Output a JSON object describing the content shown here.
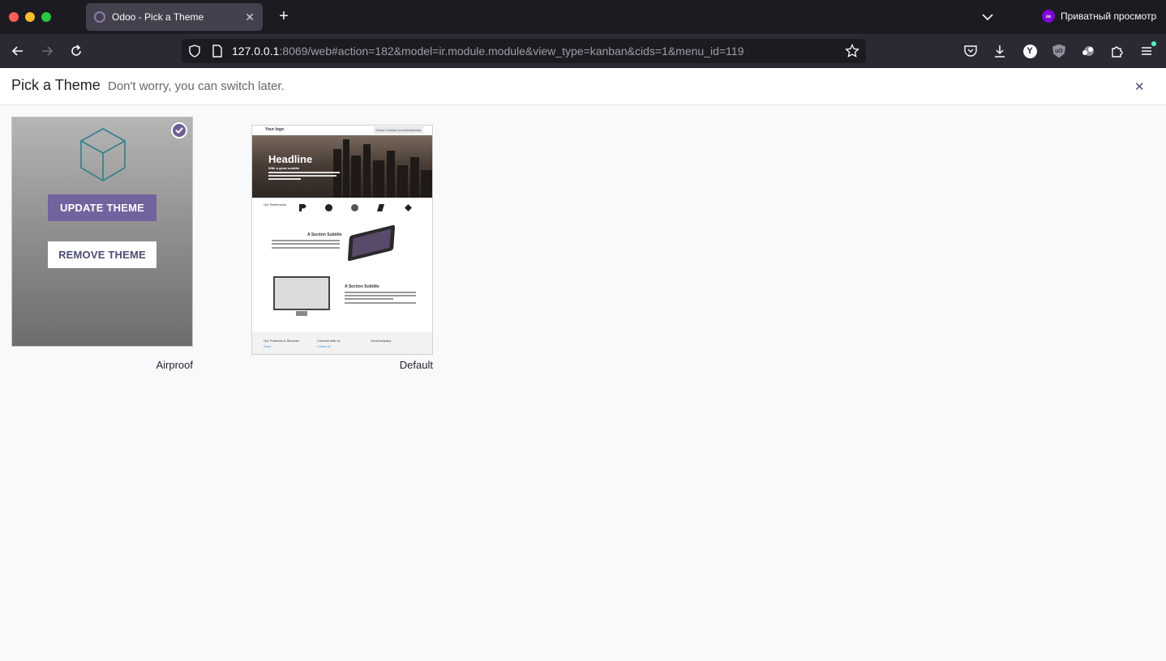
{
  "browser": {
    "tab_title": "Odoo - Pick a Theme",
    "private_label": "Приватный просмотр",
    "url_host": "127.0.0.1",
    "url_rest": ":8069/web#action=182&model=ir.module.module&view_type=kanban&cids=1&menu_id=119",
    "extension_y_label": "Y",
    "extension_ub_label": "uO"
  },
  "header": {
    "title": "Pick a Theme",
    "subtitle": "Don't worry, you can switch later."
  },
  "themes": [
    {
      "name": "Airproof",
      "installed": true,
      "update_label": "UPDATE THEME",
      "remove_label": "REMOVE THEME"
    },
    {
      "name": "Default",
      "installed": false,
      "preview": {
        "logo": "Your logo",
        "menu": "Home   Contact us   Administrator",
        "headline": "Headline",
        "headline_sub": "With a great subtitle",
        "references": "Our References",
        "section_1": "A Section Subtitle",
        "section_2": "A Section Subtitle",
        "footer_1": "Our Products & Services",
        "footer_1_link": "Home",
        "footer_2": "Connect with us",
        "footer_2_link": "Contact us",
        "footer_3": "YourCompany"
      }
    }
  ],
  "colors": {
    "odoo_primary": "#71639e",
    "check_badge": "#6f5e96",
    "cube_stroke": "#2f7f88"
  }
}
